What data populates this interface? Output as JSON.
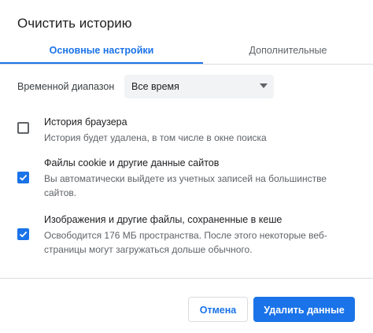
{
  "dialog": {
    "title": "Очистить историю"
  },
  "tabs": [
    {
      "label": "Основные настройки",
      "active": true
    },
    {
      "label": "Дополнительные",
      "active": false
    }
  ],
  "time_range": {
    "label": "Временной диапазон",
    "selected": "Все время"
  },
  "options": [
    {
      "title": "История браузера",
      "description": "История будет удалена, в том числе в окне поиска",
      "checked": false
    },
    {
      "title": "Файлы cookie и другие данные сайтов",
      "description": "Вы автоматически выйдете из учетных записей на большинстве сайтов.",
      "checked": true
    },
    {
      "title": "Изображения и другие файлы, сохраненные в кеше",
      "description": "Освободится 176 МБ пространства. После этого некоторые веб-страницы могут загружаться дольше обычного.",
      "checked": true
    }
  ],
  "buttons": {
    "cancel": "Отмена",
    "delete": "Удалить данные"
  },
  "colors": {
    "accent": "#1a73e8",
    "text_primary": "#202124",
    "text_secondary": "#5f6368",
    "divider": "#dadce0",
    "select_bg": "#f1f3f4"
  },
  "icons": {
    "dropdown": "chevron-down-icon",
    "checkmark": "checkmark-icon"
  }
}
